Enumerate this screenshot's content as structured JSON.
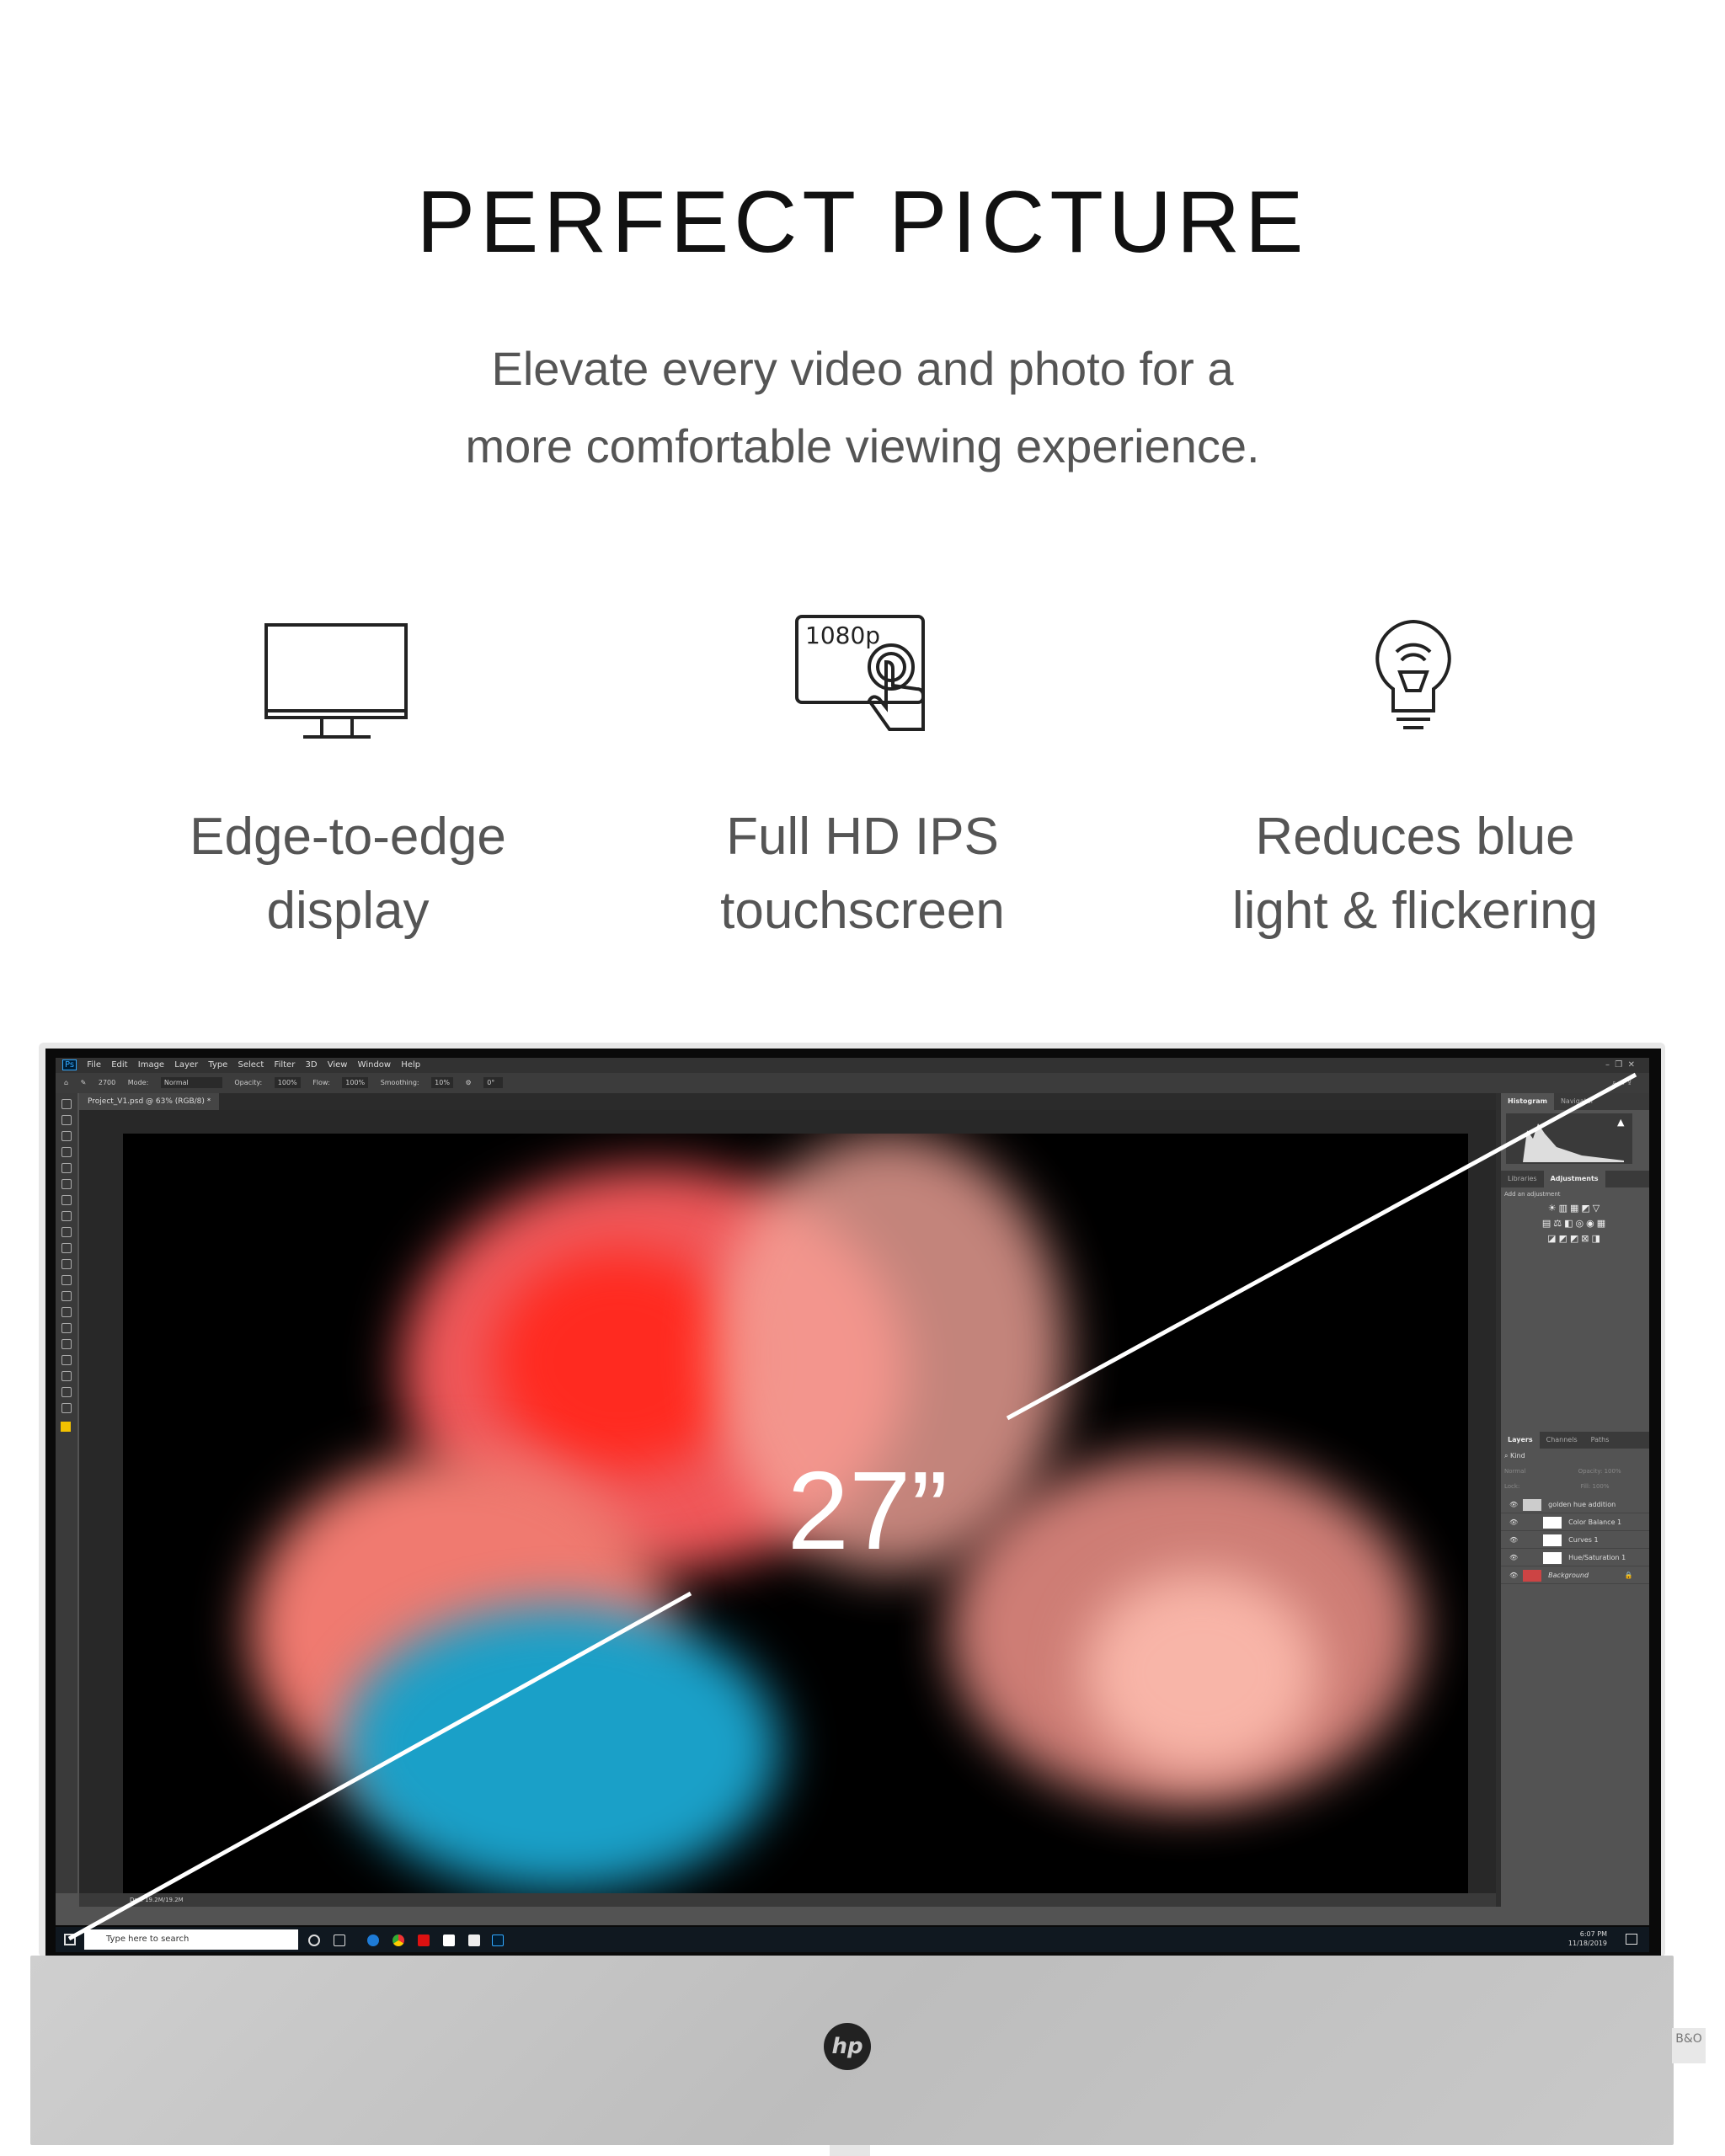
{
  "header": {
    "title": "PERFECT PICTURE",
    "subtitle_lines": [
      "Elevate every video and photo for a",
      "more comfortable viewing experience."
    ]
  },
  "features": [
    {
      "icon": "monitor-icon",
      "lines": [
        "Edge-to-edge",
        "display"
      ]
    },
    {
      "icon": "touch-1080p-icon",
      "icon_text": "1080p",
      "lines": [
        "Full HD IPS",
        "touchscreen"
      ]
    },
    {
      "icon": "lightbulb-icon",
      "lines": [
        "Reduces blue",
        "light & flickering"
      ]
    }
  ],
  "screen_size": "27”",
  "photoshop": {
    "menu": [
      "File",
      "Edit",
      "Image",
      "Layer",
      "Type",
      "Select",
      "Filter",
      "3D",
      "View",
      "Window",
      "Help"
    ],
    "options": {
      "brush_size": "2700",
      "mode_label": "Mode:",
      "mode": "Normal",
      "opacity_label": "Opacity:",
      "opacity": "100%",
      "flow_label": "Flow:",
      "flow": "100%",
      "smoothing_label": "Smoothing:",
      "smoothing": "10%",
      "angle": "0°"
    },
    "doc_tab": "Project_V1.psd @ 63% (RGB/8) *",
    "status": "Doc: 19.2M/19.2M",
    "panel_tabs_top": [
      "Histogram",
      "Navigator"
    ],
    "panel_tabs_mid": [
      "Libraries",
      "Adjustments"
    ],
    "add_adjustment": "Add an adjustment",
    "layer_tabs": [
      "Layers",
      "Channels",
      "Paths"
    ],
    "kind": "Kind",
    "blend": "Normal",
    "opacity_label": "Opacity:",
    "opacity": "100%",
    "lock_label": "Lock:",
    "fill_label": "Fill:",
    "fill": "100%",
    "layers": [
      "golden hue addition",
      "Color Balance 1",
      "Curves 1",
      "Hue/Saturation 1",
      "Background"
    ]
  },
  "taskbar": {
    "search_placeholder": "Type here to search",
    "time": "6:07 PM",
    "date": "11/18/2019"
  },
  "brand": {
    "logo": "hp",
    "speaker_badge": "B&O"
  }
}
